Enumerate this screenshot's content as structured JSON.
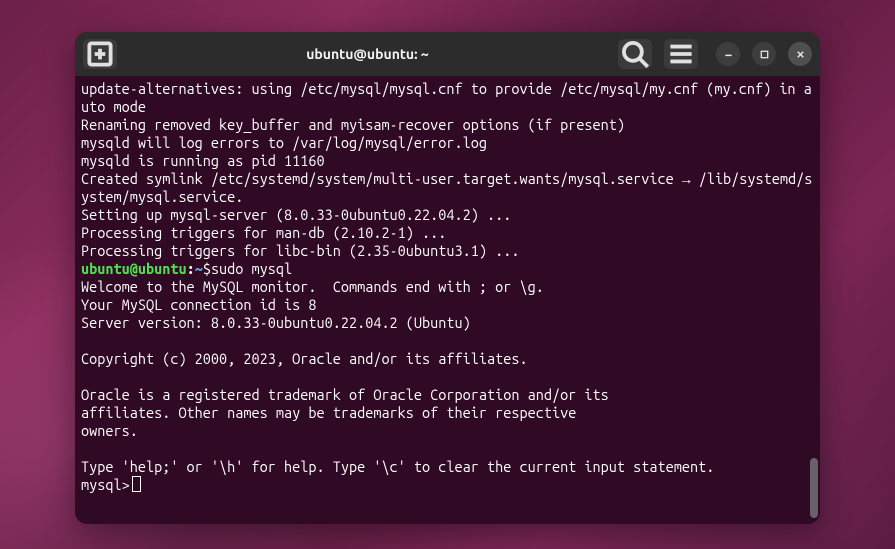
{
  "titlebar": {
    "title": "ubuntu@ubuntu: ~"
  },
  "prompt": {
    "user_host": "ubuntu@ubuntu",
    "path": "~",
    "command": "sudo mysql"
  },
  "terminal": {
    "pre_lines": "update-alternatives: using /etc/mysql/mysql.cnf to provide /etc/mysql/my.cnf (my.cnf) in auto mode\nRenaming removed key_buffer and myisam-recover options (if present)\nmysqld will log errors to /var/log/mysql/error.log\nmysqld is running as pid 11160\nCreated symlink /etc/systemd/system/multi-user.target.wants/mysql.service → /lib/systemd/system/mysql.service.\nSetting up mysql-server (8.0.33-0ubuntu0.22.04.2) ...\nProcessing triggers for man-db (2.10.2-1) ...\nProcessing triggers for libc-bin (2.35-0ubuntu3.1) ...",
    "post_lines": "Welcome to the MySQL monitor.  Commands end with ; or \\g.\nYour MySQL connection id is 8\nServer version: 8.0.33-0ubuntu0.22.04.2 (Ubuntu)\n\nCopyright (c) 2000, 2023, Oracle and/or its affiliates.\n\nOracle is a registered trademark of Oracle Corporation and/or its\naffiliates. Other names may be trademarks of their respective\nowners.\n\nType 'help;' or '\\h' for help. Type '\\c' to clear the current input statement.\n",
    "mysql_prompt": "mysql> "
  }
}
